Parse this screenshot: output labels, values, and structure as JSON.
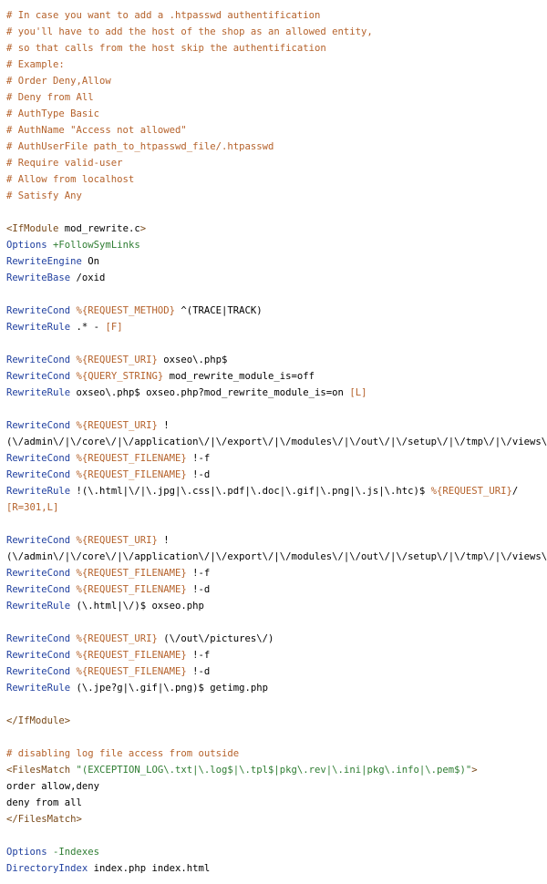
{
  "lines": [
    [
      {
        "t": "# In case you want to add a .htpasswd authentification",
        "c": "comment"
      }
    ],
    [
      {
        "t": "# you'll have to add the host of the shop as an allowed entity,",
        "c": "comment"
      }
    ],
    [
      {
        "t": "# so that calls from the host skip the authentification",
        "c": "comment"
      }
    ],
    [
      {
        "t": "# Example:",
        "c": "comment"
      }
    ],
    [
      {
        "t": "# Order Deny,Allow",
        "c": "comment"
      }
    ],
    [
      {
        "t": "# Deny from All",
        "c": "comment"
      }
    ],
    [
      {
        "t": "# AuthType Basic",
        "c": "comment"
      }
    ],
    [
      {
        "t": "# AuthName \"Access not allowed\"",
        "c": "comment"
      }
    ],
    [
      {
        "t": "# AuthUserFile path_to_htpasswd_file/.htpasswd",
        "c": "comment"
      }
    ],
    [
      {
        "t": "# Require valid-user",
        "c": "comment"
      }
    ],
    [
      {
        "t": "# Allow from localhost",
        "c": "comment"
      }
    ],
    [
      {
        "t": "# Satisfy Any",
        "c": "comment"
      }
    ],
    [],
    [
      {
        "t": "<IfModule",
        "c": "tag"
      },
      {
        "t": " mod_rewrite.c",
        "c": "plain"
      },
      {
        "t": ">",
        "c": "tag"
      }
    ],
    [
      {
        "t": "Options",
        "c": "directive"
      },
      {
        "t": " +FollowSymLinks",
        "c": "str"
      }
    ],
    [
      {
        "t": "RewriteEngine",
        "c": "directive"
      },
      {
        "t": " On",
        "c": "plain"
      }
    ],
    [
      {
        "t": "RewriteBase",
        "c": "directive"
      },
      {
        "t": " /oxid",
        "c": "plain"
      }
    ],
    [],
    [
      {
        "t": "RewriteCond",
        "c": "directive"
      },
      {
        "t": " %{REQUEST_METHOD}",
        "c": "var"
      },
      {
        "t": " ^(TRACE|TRACK)",
        "c": "plain"
      }
    ],
    [
      {
        "t": "RewriteRule",
        "c": "directive"
      },
      {
        "t": " .* - ",
        "c": "plain"
      },
      {
        "t": "[F]",
        "c": "var"
      }
    ],
    [],
    [
      {
        "t": "RewriteCond",
        "c": "directive"
      },
      {
        "t": " %{REQUEST_URI}",
        "c": "var"
      },
      {
        "t": " oxseo\\.php$",
        "c": "plain"
      }
    ],
    [
      {
        "t": "RewriteCond",
        "c": "directive"
      },
      {
        "t": " %{QUERY_STRING}",
        "c": "var"
      },
      {
        "t": " mod_rewrite_module_is=off",
        "c": "plain"
      }
    ],
    [
      {
        "t": "RewriteRule",
        "c": "directive"
      },
      {
        "t": " oxseo\\.php$ oxseo.php?mod_rewrite_module_is=on ",
        "c": "plain"
      },
      {
        "t": "[L]",
        "c": "var"
      }
    ],
    [],
    [
      {
        "t": "RewriteCond",
        "c": "directive"
      },
      {
        "t": " %{REQUEST_URI}",
        "c": "var"
      },
      {
        "t": " !",
        "c": "plain"
      }
    ],
    [
      {
        "t": "(\\/admin\\/|\\/core\\/|\\/application\\/|\\/export\\/|\\/modules\\/|\\/out\\/|\\/setup\\/|\\/tmp\\/|\\/views\\/)",
        "c": "plain"
      }
    ],
    [
      {
        "t": "RewriteCond",
        "c": "directive"
      },
      {
        "t": " %{REQUEST_FILENAME}",
        "c": "var"
      },
      {
        "t": " !-f",
        "c": "plain"
      }
    ],
    [
      {
        "t": "RewriteCond",
        "c": "directive"
      },
      {
        "t": " %{REQUEST_FILENAME}",
        "c": "var"
      },
      {
        "t": " !-d",
        "c": "plain"
      }
    ],
    [
      {
        "t": "RewriteRule",
        "c": "directive"
      },
      {
        "t": " !(\\.html|\\/|\\.jpg|\\.css|\\.pdf|\\.doc|\\.gif|\\.png|\\.js|\\.htc)$ ",
        "c": "plain"
      },
      {
        "t": "%{REQUEST_URI}",
        "c": "var"
      },
      {
        "t": "/",
        "c": "plain"
      }
    ],
    [
      {
        "t": "[R=301,L]",
        "c": "var"
      }
    ],
    [],
    [
      {
        "t": "RewriteCond",
        "c": "directive"
      },
      {
        "t": " %{REQUEST_URI}",
        "c": "var"
      },
      {
        "t": " !",
        "c": "plain"
      }
    ],
    [
      {
        "t": "(\\/admin\\/|\\/core\\/|\\/application\\/|\\/export\\/|\\/modules\\/|\\/out\\/|\\/setup\\/|\\/tmp\\/|\\/views\\/)",
        "c": "plain"
      }
    ],
    [
      {
        "t": "RewriteCond",
        "c": "directive"
      },
      {
        "t": " %{REQUEST_FILENAME}",
        "c": "var"
      },
      {
        "t": " !-f",
        "c": "plain"
      }
    ],
    [
      {
        "t": "RewriteCond",
        "c": "directive"
      },
      {
        "t": " %{REQUEST_FILENAME}",
        "c": "var"
      },
      {
        "t": " !-d",
        "c": "plain"
      }
    ],
    [
      {
        "t": "RewriteRule",
        "c": "directive"
      },
      {
        "t": " (\\.html|\\/)$ oxseo.php",
        "c": "plain"
      }
    ],
    [],
    [
      {
        "t": "RewriteCond",
        "c": "directive"
      },
      {
        "t": " %{REQUEST_URI}",
        "c": "var"
      },
      {
        "t": " (\\/out\\/pictures\\/)",
        "c": "plain"
      }
    ],
    [
      {
        "t": "RewriteCond",
        "c": "directive"
      },
      {
        "t": " %{REQUEST_FILENAME}",
        "c": "var"
      },
      {
        "t": " !-f",
        "c": "plain"
      }
    ],
    [
      {
        "t": "RewriteCond",
        "c": "directive"
      },
      {
        "t": " %{REQUEST_FILENAME}",
        "c": "var"
      },
      {
        "t": " !-d",
        "c": "plain"
      }
    ],
    [
      {
        "t": "RewriteRule",
        "c": "directive"
      },
      {
        "t": " (\\.jpe?g|\\.gif|\\.png)$ getimg.php",
        "c": "plain"
      }
    ],
    [],
    [
      {
        "t": "</IfModule>",
        "c": "tag"
      }
    ],
    [],
    [
      {
        "t": "# disabling log file access from outside",
        "c": "comment"
      }
    ],
    [
      {
        "t": "<FilesMatch",
        "c": "tag"
      },
      {
        "t": " \"(EXCEPTION_LOG\\.txt|\\.log$|\\.tpl$|pkg\\.rev|\\.ini|pkg\\.info|\\.pem$)\"",
        "c": "str"
      },
      {
        "t": ">",
        "c": "tag"
      }
    ],
    [
      {
        "t": "order allow,deny",
        "c": "plain"
      }
    ],
    [
      {
        "t": "deny from all",
        "c": "plain"
      }
    ],
    [
      {
        "t": "</FilesMatch>",
        "c": "tag"
      }
    ],
    [],
    [
      {
        "t": "Options",
        "c": "directive"
      },
      {
        "t": " -Indexes",
        "c": "str"
      }
    ],
    [
      {
        "t": "DirectoryIndex",
        "c": "directive"
      },
      {
        "t": " index.php index.html",
        "c": "plain"
      }
    ]
  ]
}
